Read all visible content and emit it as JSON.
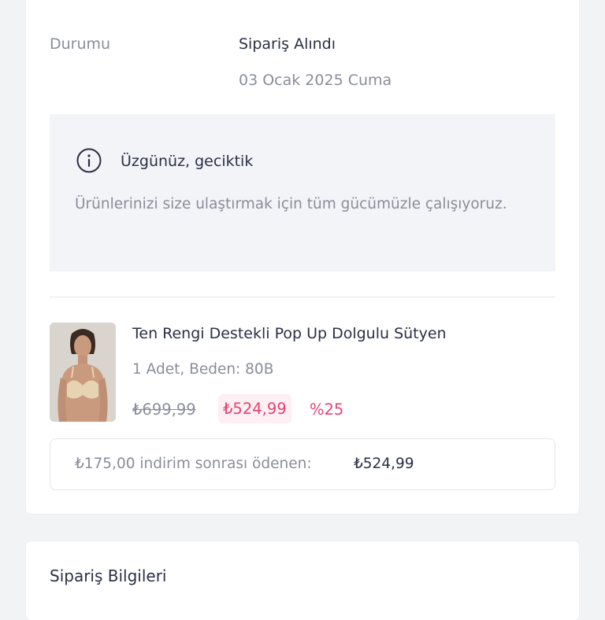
{
  "order": {
    "status_label": "Durumu",
    "status_value": "Sipariş Alındı",
    "status_date": "03 Ocak 2025 Cuma"
  },
  "notice": {
    "icon": "info-icon",
    "title": "Üzgünüz, geciktik",
    "text": "Ürünlerinizi size ulaştırmak için tüm gücümüzle çalışıyoruz."
  },
  "product": {
    "image_icon": "product-photo",
    "name": "Ten Rengi Destekli Pop Up Dolgulu Sütyen",
    "meta": "1 Adet, Beden: 80B",
    "price_old": "₺699,99",
    "price_new": "₺524,99",
    "discount": "%25"
  },
  "summary": {
    "label": "₺175,00 indirim sonrası ödenen:",
    "value": "₺524,99"
  },
  "section": {
    "title": "Sipariş Bilgileri"
  },
  "colors": {
    "accent": "#e6436f",
    "accent_bg": "#fdeff3",
    "text_primary": "#2a2f45",
    "text_secondary": "#8a8d9a",
    "notice_bg": "#f3f4f7"
  }
}
